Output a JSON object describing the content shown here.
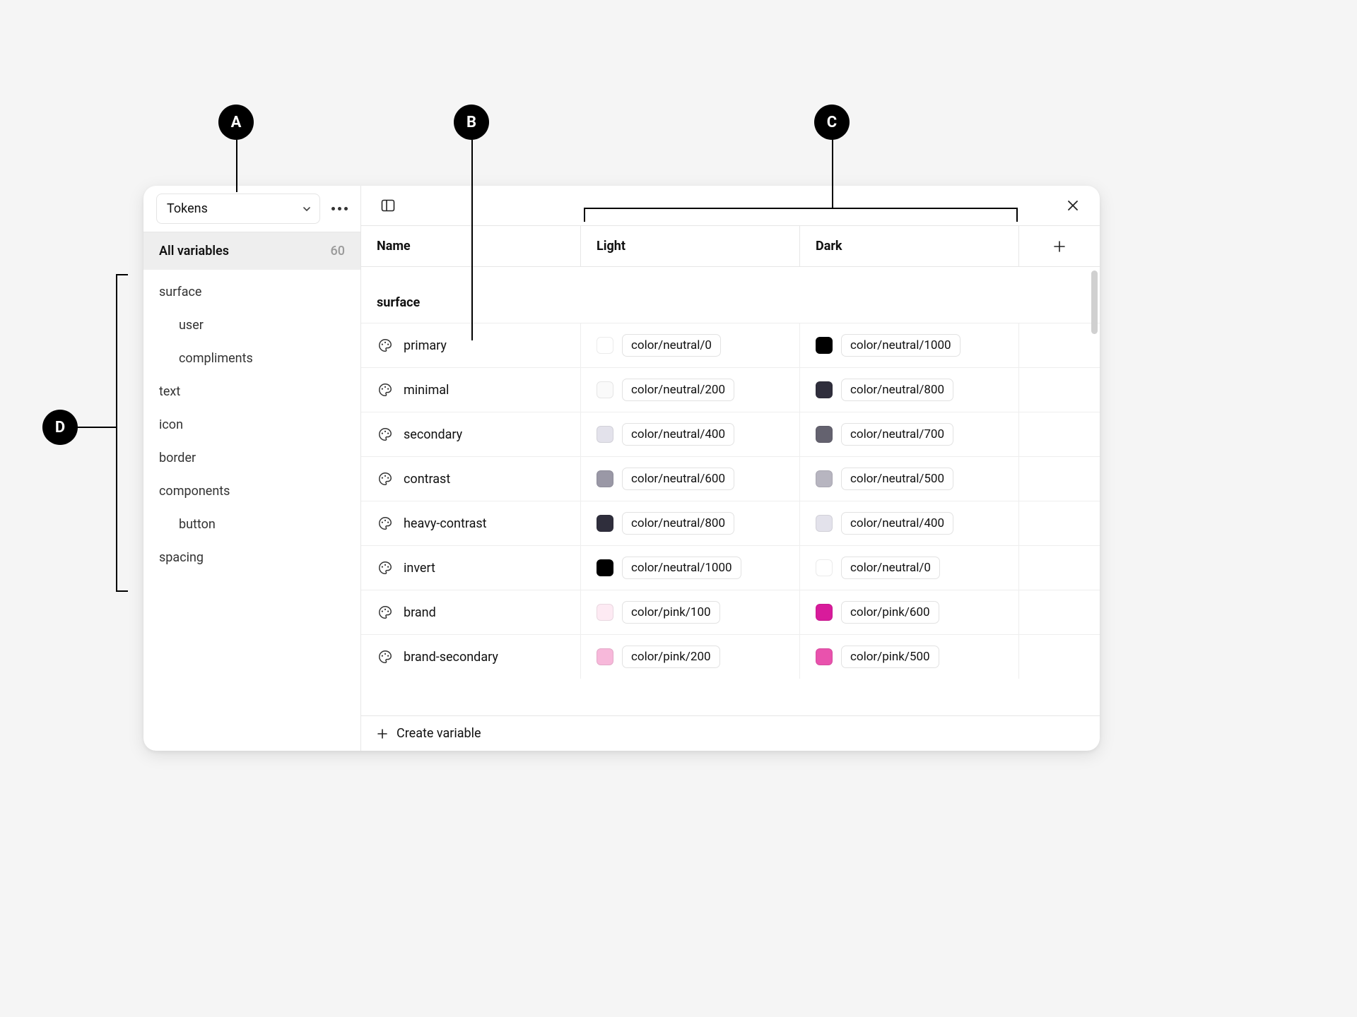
{
  "annotations": {
    "a": "A",
    "b": "B",
    "c": "C",
    "d": "D"
  },
  "select": {
    "label": "Tokens"
  },
  "all_variables": {
    "label": "All variables",
    "count": "60"
  },
  "sidebar_groups": [
    {
      "label": "surface",
      "child": false
    },
    {
      "label": "user",
      "child": true
    },
    {
      "label": "compliments",
      "child": true
    },
    {
      "label": "text",
      "child": false
    },
    {
      "label": "icon",
      "child": false
    },
    {
      "label": "border",
      "child": false
    },
    {
      "label": "components",
      "child": false
    },
    {
      "label": "button",
      "child": true
    },
    {
      "label": "spacing",
      "child": false
    }
  ],
  "headers": {
    "name": "Name",
    "light": "Light",
    "dark": "Dark"
  },
  "group_title": "surface",
  "rows": [
    {
      "name": "primary",
      "light": {
        "alias": "color/neutral/0",
        "swatch": "#ffffff"
      },
      "dark": {
        "alias": "color/neutral/1000",
        "swatch": "#000000"
      }
    },
    {
      "name": "minimal",
      "light": {
        "alias": "color/neutral/200",
        "swatch": "#fafafa"
      },
      "dark": {
        "alias": "color/neutral/800",
        "swatch": "#2f2e3c"
      }
    },
    {
      "name": "secondary",
      "light": {
        "alias": "color/neutral/400",
        "swatch": "#e3e2eb"
      },
      "dark": {
        "alias": "color/neutral/700",
        "swatch": "#64626f"
      }
    },
    {
      "name": "contrast",
      "light": {
        "alias": "color/neutral/600",
        "swatch": "#9a98a6"
      },
      "dark": {
        "alias": "color/neutral/500",
        "swatch": "#b7b5c0"
      }
    },
    {
      "name": "heavy-contrast",
      "light": {
        "alias": "color/neutral/800",
        "swatch": "#2f2e3c"
      },
      "dark": {
        "alias": "color/neutral/400",
        "swatch": "#e3e2eb"
      }
    },
    {
      "name": "invert",
      "light": {
        "alias": "color/neutral/1000",
        "swatch": "#000000"
      },
      "dark": {
        "alias": "color/neutral/0",
        "swatch": "#ffffff"
      }
    },
    {
      "name": "brand",
      "light": {
        "alias": "color/pink/100",
        "swatch": "#fdeaf3"
      },
      "dark": {
        "alias": "color/pink/600",
        "swatch": "#d81b9b"
      }
    },
    {
      "name": "brand-secondary",
      "light": {
        "alias": "color/pink/200",
        "swatch": "#f7b8da"
      },
      "dark": {
        "alias": "color/pink/500",
        "swatch": "#e952ad"
      }
    }
  ],
  "footer": {
    "label": "Create variable"
  }
}
